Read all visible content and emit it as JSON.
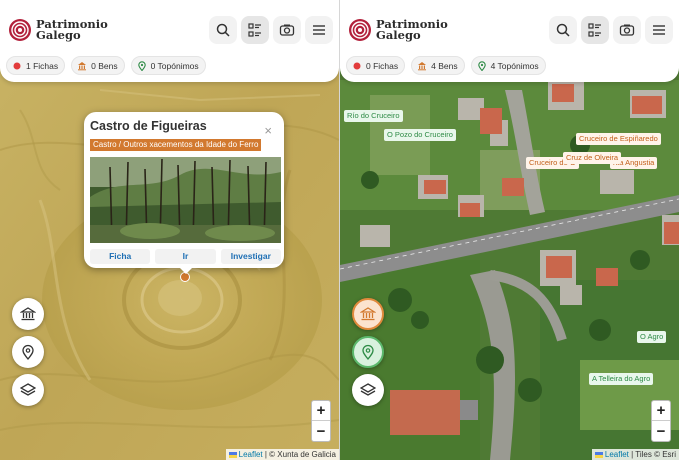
{
  "brand": {
    "line1": "Patrimonio",
    "line2": "Galego"
  },
  "left": {
    "chips": [
      {
        "label": "1 Fichas",
        "icon": "red-dot-icon"
      },
      {
        "label": "0 Bens",
        "icon": "museum-icon"
      },
      {
        "label": "0 Topónimos",
        "icon": "map-pin-icon"
      }
    ],
    "popup": {
      "title": "Castro de Figueiras",
      "close": "×",
      "tag": "Castro / Outros xacementos da Idade do Ferro",
      "buttons": [
        "Ficha",
        "Ir",
        "Investigar"
      ]
    },
    "attribution": {
      "leaflet": "Leaflet",
      "rest": " | © Xunta de Galicia"
    }
  },
  "right": {
    "chips": [
      {
        "label": "0 Fichas",
        "icon": "red-dot-icon"
      },
      {
        "label": "4 Bens",
        "icon": "museum-icon"
      },
      {
        "label": "4 Topónimos",
        "icon": "map-pin-icon"
      }
    ],
    "labels": {
      "rio_do_cruceiro": "Río do Cruceiro",
      "pozo_do_cruceiro": "O Pozo do Cruceiro",
      "cruceiro_espinaredo": "Cruceiro de Espiñaredo",
      "cruz_de_olveira": "Cruz de Olveira",
      "cruceiro_de_o": "Cruceiro de O",
      "nta_angustia": "nta Angustia",
      "o_agro": "O Agro",
      "telleira_do_agro": "A Telleira do Agro"
    },
    "attribution": {
      "leaflet": "Leaflet",
      "rest": " | Tiles © Esri"
    }
  },
  "zoom": {
    "in": "+",
    "out": "−"
  },
  "colors": {
    "accent": "#d2792f",
    "green": "#2e8b46",
    "red": "#e23b3b"
  }
}
